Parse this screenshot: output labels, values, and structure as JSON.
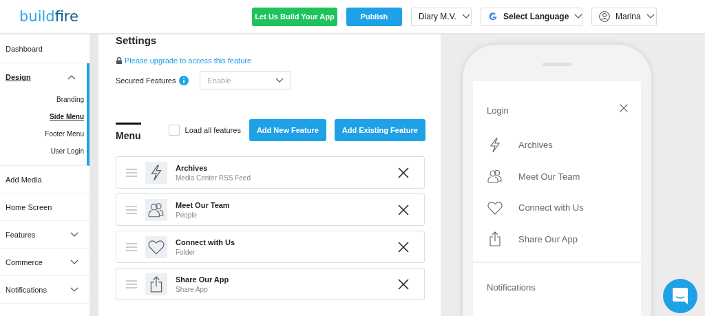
{
  "header": {
    "logo": {
      "prefix": "build",
      "suffix": "fire"
    },
    "build_button": "Let Us Build Your App",
    "publish_button": "Publish",
    "app_select": "Diary M.V.",
    "language_select": "Select Language",
    "user_select": "Marina"
  },
  "sidebar": {
    "items": [
      {
        "label": "Dashboard",
        "kind": "link",
        "selected": false
      },
      {
        "label": "Design",
        "kind": "group",
        "selected": true,
        "expanded": true,
        "children": [
          {
            "label": "Branding",
            "selected": false
          },
          {
            "label": "Side Menu",
            "selected": true
          },
          {
            "label": "Footer Menu",
            "selected": false
          },
          {
            "label": "User Login",
            "selected": false
          }
        ]
      },
      {
        "label": "Add Media",
        "kind": "link",
        "selected": false
      },
      {
        "label": "Home Screen",
        "kind": "link",
        "selected": false
      },
      {
        "label": "Features",
        "kind": "group",
        "selected": false,
        "expanded": false
      },
      {
        "label": "Commerce",
        "kind": "group",
        "selected": false,
        "expanded": false
      },
      {
        "label": "Notifications",
        "kind": "group",
        "selected": false,
        "expanded": false
      }
    ]
  },
  "settings": {
    "title": "Settings",
    "upgrade_link": "Please upgrade to access this feature",
    "secured_label": "Secured Features",
    "secured_select": {
      "placeholder": "Enable"
    }
  },
  "menu": {
    "title": "Menu",
    "load_all": {
      "label": "Load all features",
      "checked": false
    },
    "add_new_button": "Add New Feature",
    "add_existing_button": "Add Existing Feature",
    "features": [
      {
        "title": "Archives",
        "subtitle": "Media Center RSS Feed"
      },
      {
        "title": "Meet Our Team",
        "subtitle": "People"
      },
      {
        "title": "Connect with Us",
        "subtitle": "Folder"
      },
      {
        "title": "Share Our App",
        "subtitle": "Share App"
      }
    ]
  },
  "preview": {
    "login": "Login",
    "items": [
      "Archives",
      "Meet Our Team",
      "Connect with Us",
      "Share Our App"
    ],
    "notifications": "Notifications"
  }
}
